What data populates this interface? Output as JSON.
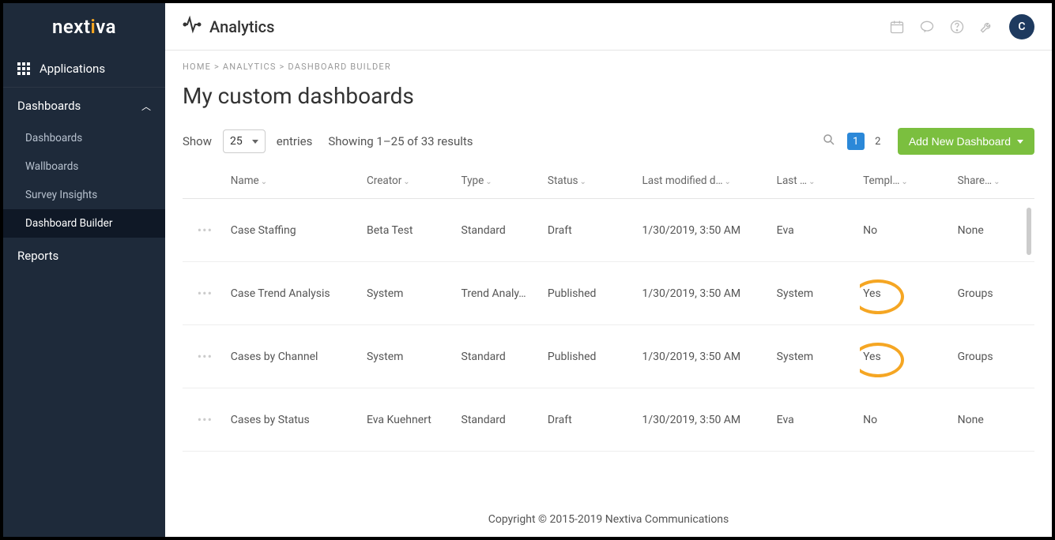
{
  "brand": "nextiva",
  "header": {
    "title": "Analytics",
    "avatar_initial": "C"
  },
  "sidebar": {
    "applications_label": "Applications",
    "dashboards_label": "Dashboards",
    "items": [
      {
        "label": "Dashboards"
      },
      {
        "label": "Wallboards"
      },
      {
        "label": "Survey Insights"
      },
      {
        "label": "Dashboard Builder"
      }
    ],
    "reports_label": "Reports"
  },
  "breadcrumb": {
    "home": "HOME",
    "analytics": "ANALYTICS",
    "current": "DASHBOARD BUILDER",
    "sep": ">"
  },
  "page": {
    "title": "My custom dashboards",
    "show_label": "Show",
    "entries_value": "25",
    "entries_label": "entries",
    "results_text": "Showing 1–25 of 33 results",
    "pages": [
      "1",
      "2"
    ],
    "active_page": "1",
    "add_button": "Add New Dashboard"
  },
  "columns": {
    "name": "Name",
    "creator": "Creator",
    "type": "Type",
    "status": "Status",
    "modified": "Last modified d…",
    "by": "Last …",
    "template": "Templ…",
    "shared": "Share…"
  },
  "rows": [
    {
      "name": "Case Staffing",
      "creator": "Beta Test",
      "type": "Standard",
      "status": "Draft",
      "modified": "1/30/2019, 3:50 AM",
      "by": "Eva",
      "template": "No",
      "shared": "None",
      "hl": false
    },
    {
      "name": "Case Trend Analysis",
      "creator": "System",
      "type": "Trend Analy…",
      "status": "Published",
      "modified": "1/30/2019, 3:50 AM",
      "by": "System",
      "template": "Yes",
      "shared": "Groups",
      "hl": true
    },
    {
      "name": "Cases by Channel",
      "creator": "System",
      "type": "Standard",
      "status": "Published",
      "modified": "1/30/2019, 3:50 AM",
      "by": "System",
      "template": "Yes",
      "shared": "Groups",
      "hl": true
    },
    {
      "name": "Cases by Status",
      "creator": "Eva Kuehnert",
      "type": "Standard",
      "status": "Draft",
      "modified": "1/30/2019, 3:50 AM",
      "by": "Eva",
      "template": "No",
      "shared": "None",
      "hl": false
    }
  ],
  "footer": "Copyright © 2015-2019 Nextiva Communications"
}
